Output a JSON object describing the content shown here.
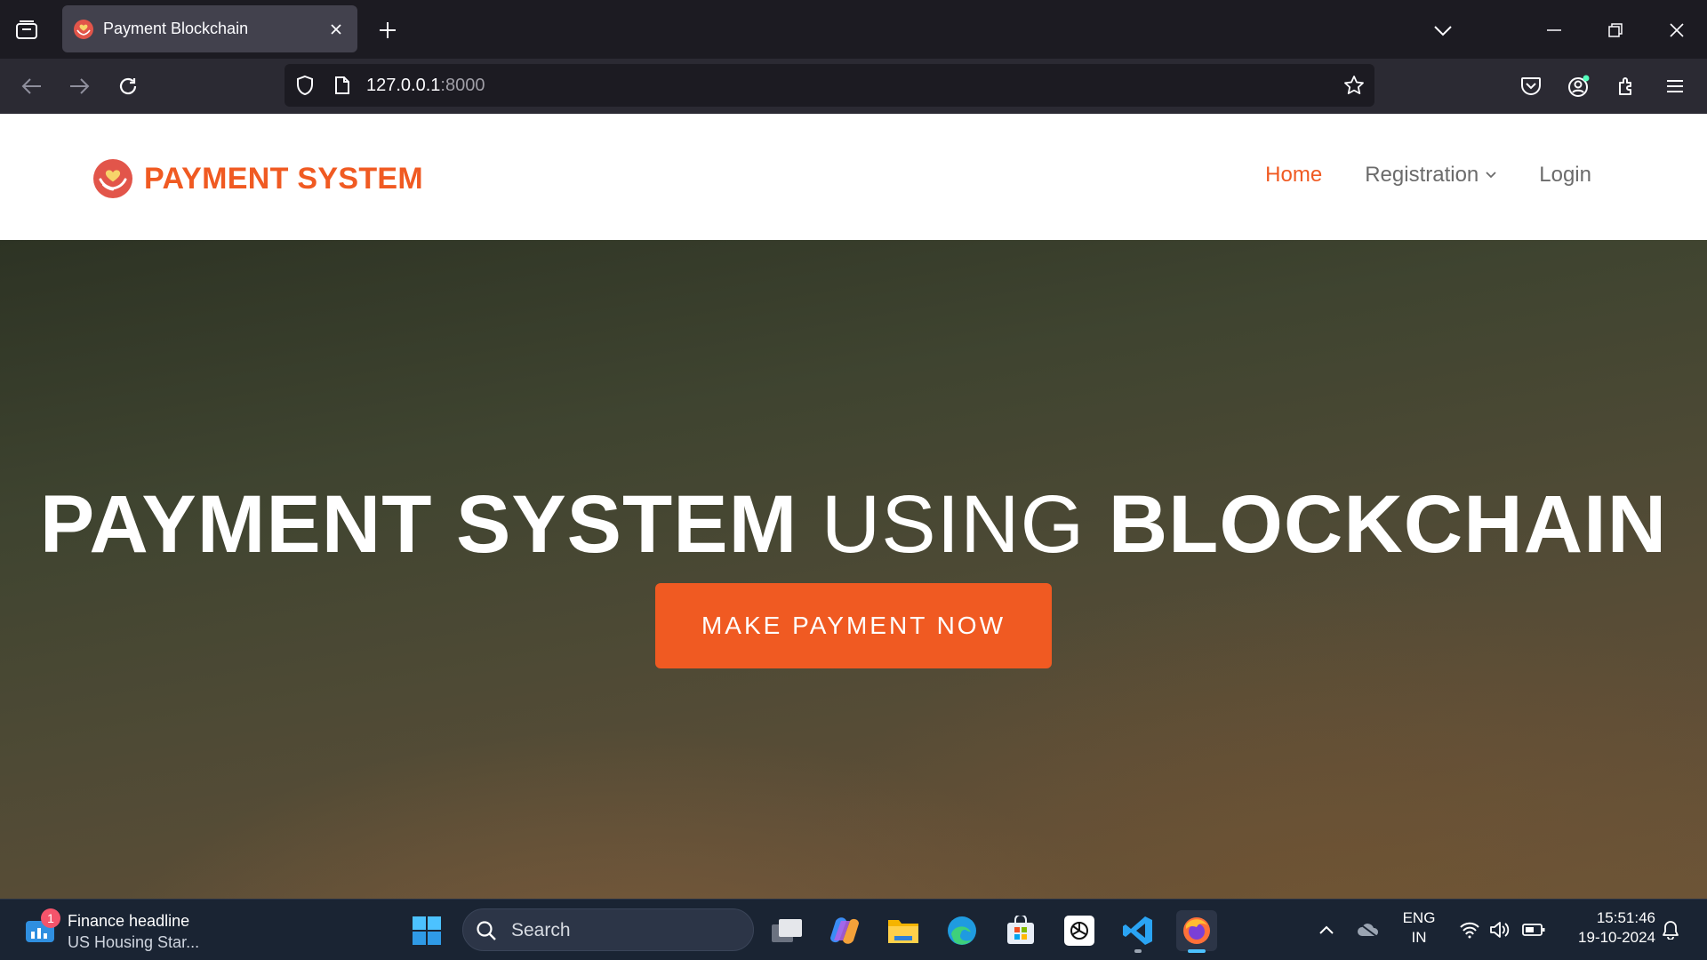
{
  "browser": {
    "tab_title": "Payment Blockchain",
    "url_host": "127.0.0.1",
    "url_port": ":8000"
  },
  "site": {
    "brand": "PAYMENT SYSTEM",
    "menu": {
      "home": "Home",
      "registration": "Registration",
      "login": "Login"
    },
    "hero": {
      "title_part1": "PAYMENT SYSTEM",
      "title_part2": " USING ",
      "title_part3": "BLOCKCHAIN",
      "cta": "MAKE PAYMENT NOW"
    },
    "colors": {
      "accent": "#f05a22"
    }
  },
  "taskbar": {
    "widget_title": "Finance headline",
    "widget_subtitle": "US Housing Star...",
    "widget_badge": "1",
    "search_label": "Search",
    "lang_line1": "ENG",
    "lang_line2": "IN",
    "time": "15:51:46",
    "date": "19-10-2024",
    "pinned_apps": [
      "task-view",
      "copilot",
      "file-explorer",
      "edge",
      "microsoft-store",
      "chatgpt",
      "vscode",
      "firefox"
    ]
  }
}
